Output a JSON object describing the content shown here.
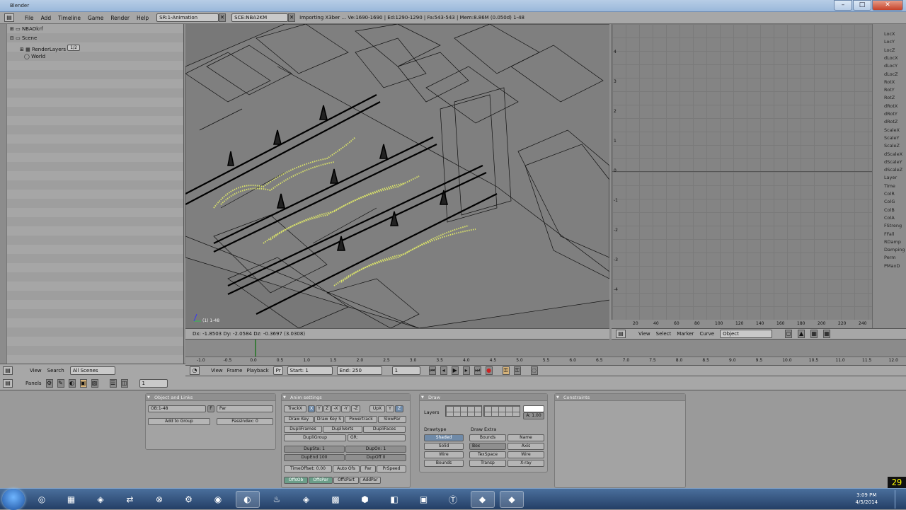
{
  "titlebar": {
    "title": "Blender"
  },
  "menubar": {
    "items": [
      "File",
      "Add",
      "Timeline",
      "Game",
      "Render",
      "Help"
    ],
    "screen": "SR:1-Animation",
    "scene": "SCE:NBA2KM",
    "info": "Importing X3ber ... Ve:1690-1690 | Ed:1290-1290 | Fa:543-543 | Mem:8.86M (0.050d) 1-48"
  },
  "outliner": {
    "items": [
      "NBAOkrf",
      "Scene",
      "RenderLayers",
      "World"
    ],
    "layer_count": "1/2"
  },
  "outliner_header": {
    "view": "View",
    "search": "Search",
    "scope": "All Scenes"
  },
  "viewport": {
    "corner_label": "(1) 1-48",
    "status": "Dx: -1.8503   Dy: -2.0584   Dz: -0.3697 (3.0308)"
  },
  "ipo": {
    "channels": [
      "LocX",
      "LocY",
      "LocZ",
      "dLocX",
      "dLocY",
      "dLocZ",
      "RotX",
      "RotY",
      "RotZ",
      "dRotX",
      "dRotY",
      "dRotZ",
      "ScaleX",
      "ScaleY",
      "ScaleZ",
      "dScaleX",
      "dScaleY",
      "dScaleZ",
      "Layer",
      "Time",
      "ColR",
      "ColG",
      "ColB",
      "ColA",
      "FStreng",
      "FFall",
      "RDamp",
      "Damping",
      "Perm",
      "PMaxD"
    ],
    "x_ticks": [
      "20",
      "40",
      "60",
      "80",
      "100",
      "120",
      "140",
      "160",
      "180",
      "200",
      "220",
      "240"
    ],
    "y_ticks": [
      "4",
      "3",
      "2",
      "1",
      "0",
      "-1",
      "-2",
      "-3",
      "-4"
    ],
    "header": {
      "view": "View",
      "select": "Select",
      "marker": "Marker",
      "curve": "Curve",
      "mode": "Object"
    }
  },
  "timeline": {
    "ticks": [
      "-1.0",
      "-0.5",
      "0.0",
      "0.5",
      "1.0",
      "1.5",
      "2.0",
      "2.5",
      "3.0",
      "3.5",
      "4.0",
      "4.5",
      "5.0",
      "5.5",
      "6.0",
      "6.5",
      "7.0",
      "7.5",
      "8.0",
      "8.5",
      "9.0",
      "9.5",
      "10.0",
      "10.5",
      "11.0",
      "11.5",
      "12.0"
    ],
    "header": {
      "view": "View",
      "frame": "Frame",
      "playback": "Playback",
      "pr": "Pr",
      "start": "Start: 1",
      "end": "End: 250",
      "current": "1"
    }
  },
  "buttons_header": {
    "panels": "Panels",
    "frame": "1"
  },
  "panels": {
    "object_links": {
      "title": "Object and Links",
      "ob": "OB:1-48",
      "f": "F",
      "par": "Par",
      "add_group": "Add to Group",
      "passindex": "PassIndex: 0"
    },
    "anim": {
      "title": "Anim settings",
      "track": "TrackX",
      "axes": [
        "X",
        "Y",
        "Z",
        "-X",
        "-Y",
        "-Z"
      ],
      "upx": "UpX",
      "upy": "Y",
      "upz": "Z",
      "drawkey": "Draw Key",
      "drawkeysel": "Draw Key S",
      "powertrack": "Powertrack",
      "slowpar": "SlowPar",
      "dupliframes": "DupliFrames",
      "dupliverts": "DupliVerts",
      "duplifaces": "DupliFaces",
      "dupligroup": "DupliGroup",
      "gr": "GR:",
      "dupsta": "DupSta: 1",
      "dupon": "DupOn: 1",
      "dupend": "DupEnd 100",
      "dupoff": "DupOff 0",
      "timeoffset": "TimeOffset: 0.00",
      "autoofs": "Auto Ofs",
      "par": "Par",
      "prspeed": "PrSpeed",
      "offsob": "OffsOb",
      "offspar": "OffsPar",
      "offspart": "OffsPart",
      "addpar": "AddPar"
    },
    "draw": {
      "title": "Draw",
      "layers": "Layers",
      "alpha": "A: 1.00",
      "drawtype_label": "Drawtype",
      "drawtype": [
        "Shaded",
        "Solid",
        "Wire",
        "Bounds"
      ],
      "drawextra_label": "Draw Extra",
      "extras_left": [
        "Bounds",
        "Box",
        "TexSpace",
        "Transp"
      ],
      "extras_right": [
        "Name",
        "Axis",
        "Wire",
        "X-ray"
      ]
    },
    "constraints": {
      "title": "Constraints"
    }
  },
  "taskbar": {
    "time": "3:09 PM",
    "date": "4/5/2014",
    "apps": [
      "ie-icon",
      "folder-icon",
      "wmp-icon",
      "network-icon",
      "game-icon",
      "gear-icon",
      "opera-icon",
      "blender-icon",
      "steam-icon",
      "app-icon",
      "minecraft-icon",
      "app-icon-2",
      "app-icon-3",
      "app-icon-4",
      "t-icon",
      "ff-icon",
      "ff-icon-2"
    ]
  },
  "fps": "29"
}
